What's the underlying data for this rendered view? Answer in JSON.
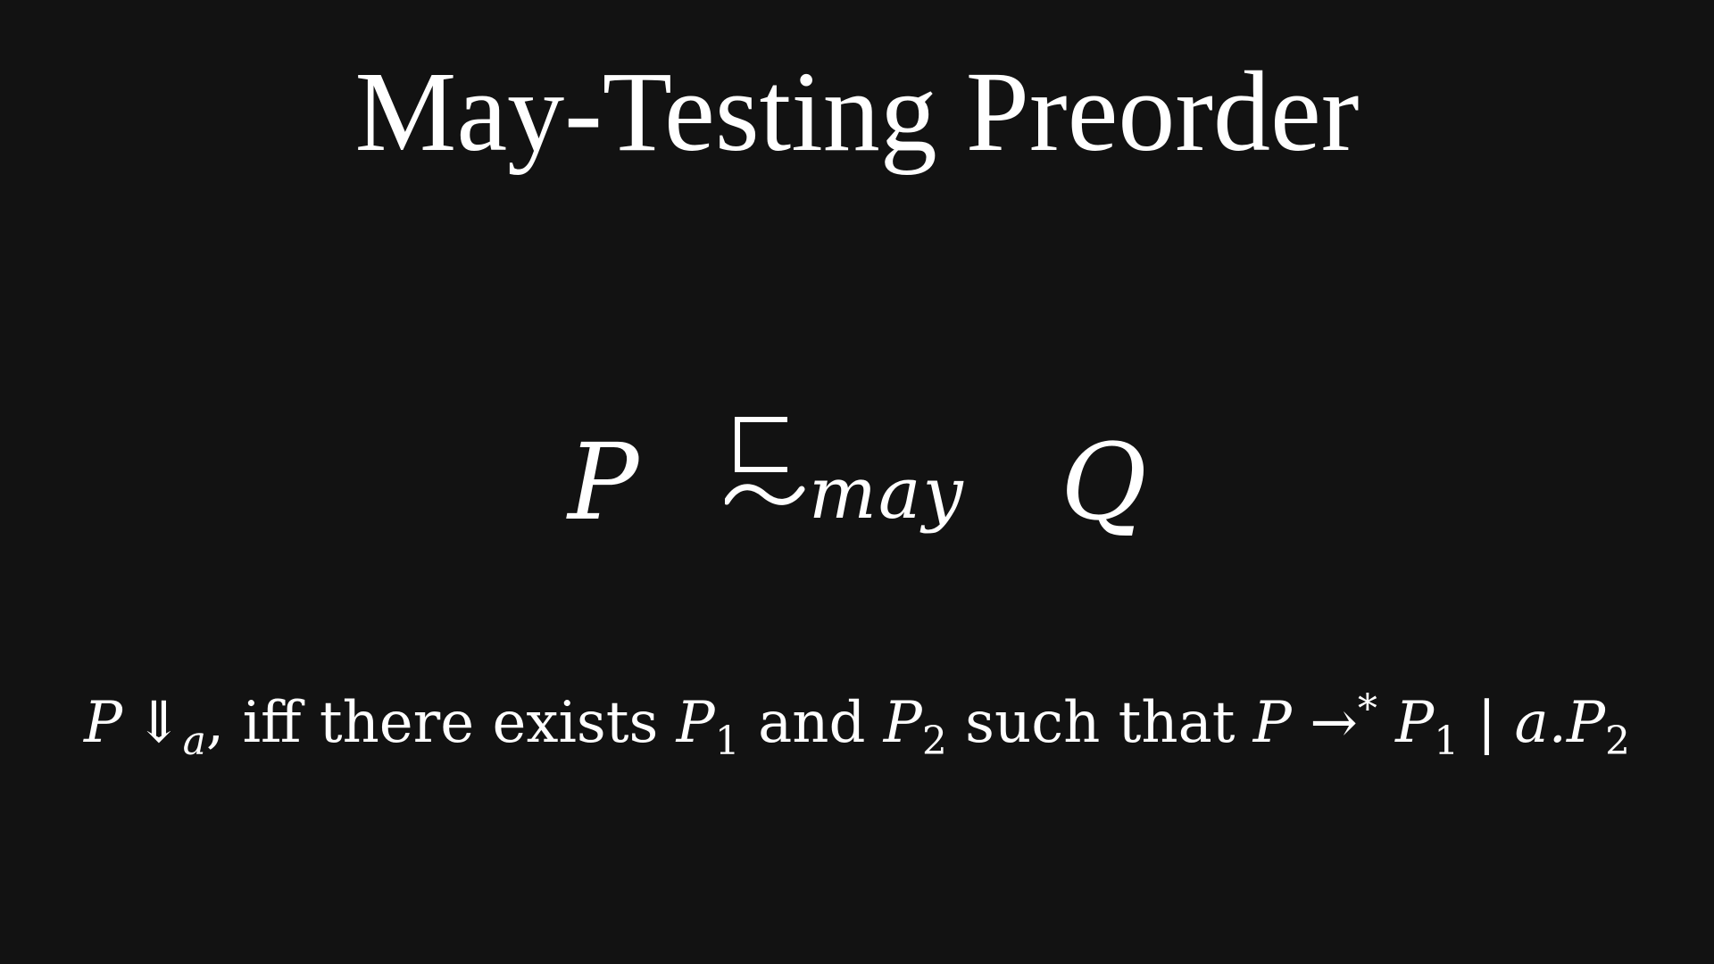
{
  "title": "May-Testing Preorder",
  "relation": {
    "left": "P",
    "symbol": "⊏∼",
    "subscript": "may",
    "right": "Q"
  },
  "definition": {
    "barb_process": "P",
    "barb_arrow": "⇓",
    "barb_label": "a",
    "comma": ",",
    "text_iff": "iff there exists",
    "p1": "P",
    "p1_sub": "1",
    "text_and": "and",
    "p2": "P",
    "p2_sub": "2",
    "text_such": "such that",
    "p": "P",
    "arrow": "→",
    "star": "*",
    "p1b": "P",
    "p1b_sub": "1",
    "par": "|",
    "prefix": "a.",
    "p2b": "P",
    "p2b_sub": "2"
  }
}
